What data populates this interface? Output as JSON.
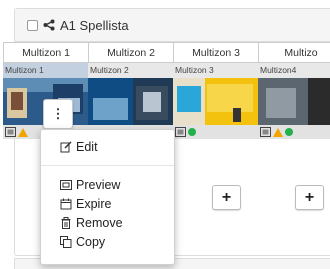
{
  "playlist": {
    "title": "A1 Spellista"
  },
  "zones": [
    {
      "tab": "Multizon 1",
      "label": "Multizon 1",
      "selected": true
    },
    {
      "tab": "Multizon 2",
      "label": "Multizon 2",
      "selected": false
    },
    {
      "tab": "Multizon 3",
      "label": "Multizon 3",
      "selected": false
    },
    {
      "tab": "Multizo",
      "label": "Multizon4",
      "selected": false
    }
  ],
  "add_label": "+",
  "kebab_label": "⋮",
  "menu": {
    "edit": "Edit",
    "preview": "Preview",
    "expire": "Expire",
    "remove": "Remove",
    "copy": "Copy"
  },
  "colors": {
    "ok_dot": "#22b14c",
    "warning": "#f0a500",
    "selected_zone": "#c3d0df"
  }
}
